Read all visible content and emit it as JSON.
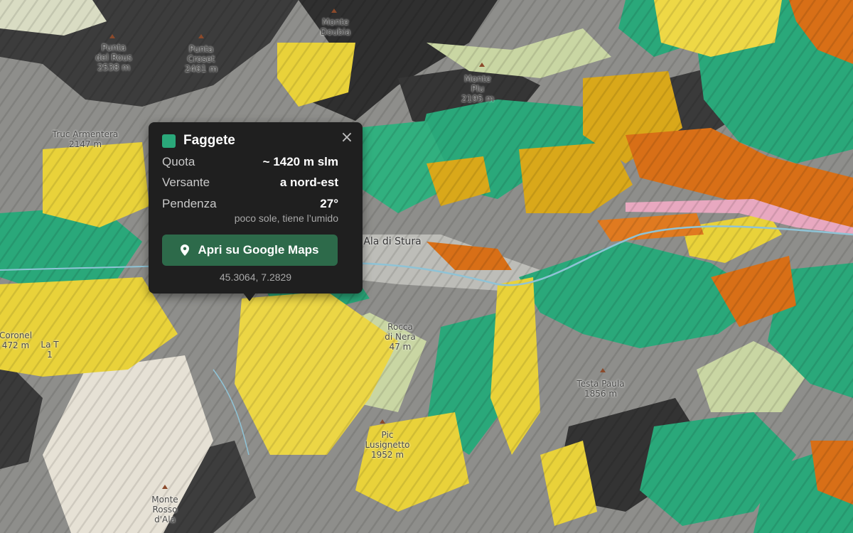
{
  "map": {
    "colors": {
      "faggete": "#2aa87a",
      "larch": "#e9d23a",
      "pine": "#d9a81a",
      "orange": "#d86f17",
      "rock": "#3a3a3a",
      "meadow": "#c9d6a3",
      "river": "#8fc3d6",
      "pink": "#e8a8c0"
    },
    "places": [
      {
        "name": "Punta\ndel Rous\n2538 m"
      },
      {
        "name": "Punta\nCroset\n2461 m"
      },
      {
        "name": "Monte\nDoubia"
      },
      {
        "name": "Truc Armentera\n2147 m"
      },
      {
        "name": "Monte\nPlu\n2195 m"
      },
      {
        "name": "Ala di Stura"
      },
      {
        "name": "Coronel\n472 m"
      },
      {
        "name": "Rocca\ndi Nera\n47 m"
      },
      {
        "name": "Testa Paula\n1856 m"
      },
      {
        "name": "Pic\nLusignetto\n1952 m"
      },
      {
        "name": "Monte\nRosso\nd'Ala"
      },
      {
        "name": "La T\n1"
      }
    ]
  },
  "popup": {
    "title": "Faggete",
    "swatch_color": "#2aa87a",
    "close_icon": "×",
    "rows": [
      {
        "label": "Quota",
        "value": "~ 1420 m slm"
      },
      {
        "label": "Versante",
        "value": "a nord-est"
      },
      {
        "label": "Pendenza",
        "value": "27°"
      }
    ],
    "note": "poco sole, tiene l’umido",
    "button_label": "Apri su Google Maps",
    "coords": "45.3064, 7.2829"
  }
}
